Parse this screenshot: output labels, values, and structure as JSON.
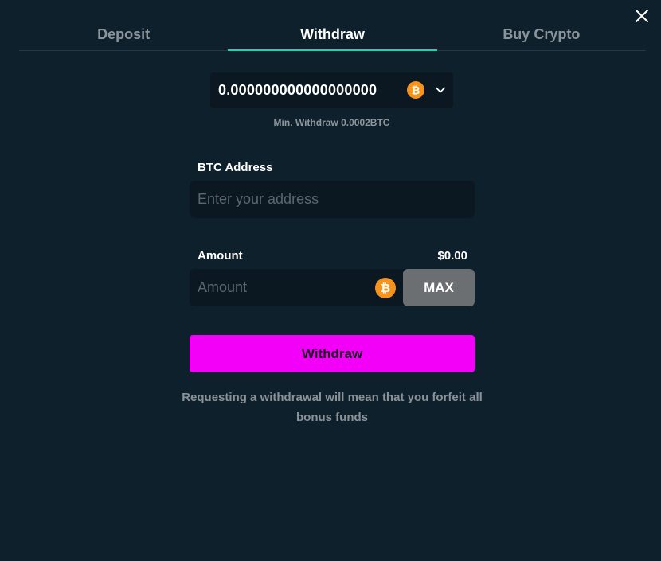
{
  "tabs": [
    {
      "label": "Deposit",
      "active": false
    },
    {
      "label": "Withdraw",
      "active": true
    },
    {
      "label": "Buy Crypto",
      "active": false
    }
  ],
  "balance": {
    "value": "0.000000000000000000",
    "currency_icon": "bitcoin-icon"
  },
  "min_withdraw": "Min. Withdraw 0.0002BTC",
  "address": {
    "label": "BTC Address",
    "placeholder": "Enter your address",
    "value": ""
  },
  "amount": {
    "label": "Amount",
    "usd_value": "$0.00",
    "placeholder": "Amount",
    "value": "",
    "max_label": "MAX"
  },
  "withdraw_button": "Withdraw",
  "notice": "Requesting a withdrawal will mean that you forfeit all bonus funds",
  "colors": {
    "accent": "#1ed4ae",
    "button": "#f200f8",
    "background": "#0f202d",
    "coin": "#f7931a"
  },
  "icons": {
    "close": "close-icon",
    "chevron": "chevron-down-icon",
    "coin": "bitcoin-icon"
  }
}
